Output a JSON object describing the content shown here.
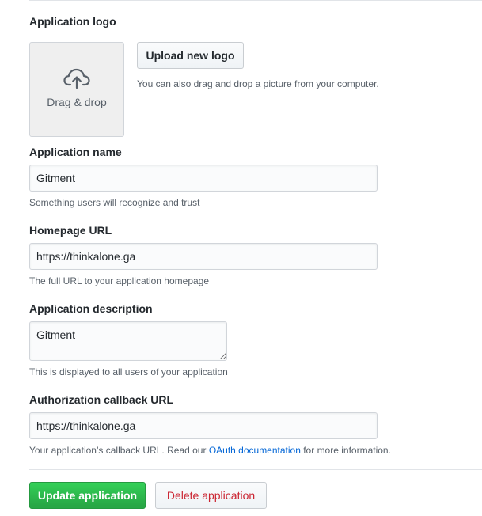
{
  "logo_section": {
    "label": "Application logo",
    "dropzone_label": "Drag & drop",
    "dropzone_icon": "cloud-upload-icon",
    "upload_button": "Upload new logo",
    "upload_hint": "You can also drag and drop a picture from your computer."
  },
  "app_name": {
    "label": "Application name",
    "value": "Gitment",
    "note": "Something users will recognize and trust"
  },
  "homepage": {
    "label": "Homepage URL",
    "value": "https://thinkalone.ga",
    "note": "The full URL to your application homepage"
  },
  "description": {
    "label": "Application description",
    "value": "Gitment",
    "note": "This is displayed to all users of your application"
  },
  "callback": {
    "label": "Authorization callback URL",
    "value": "https://thinkalone.ga",
    "note_prefix": "Your application’s callback URL. Read our ",
    "note_link": "OAuth documentation",
    "note_suffix": " for more information."
  },
  "actions": {
    "update": "Update application",
    "delete": "Delete application"
  },
  "colors": {
    "primary": "#28a745",
    "danger": "#cb2431",
    "link": "#0366d6"
  }
}
